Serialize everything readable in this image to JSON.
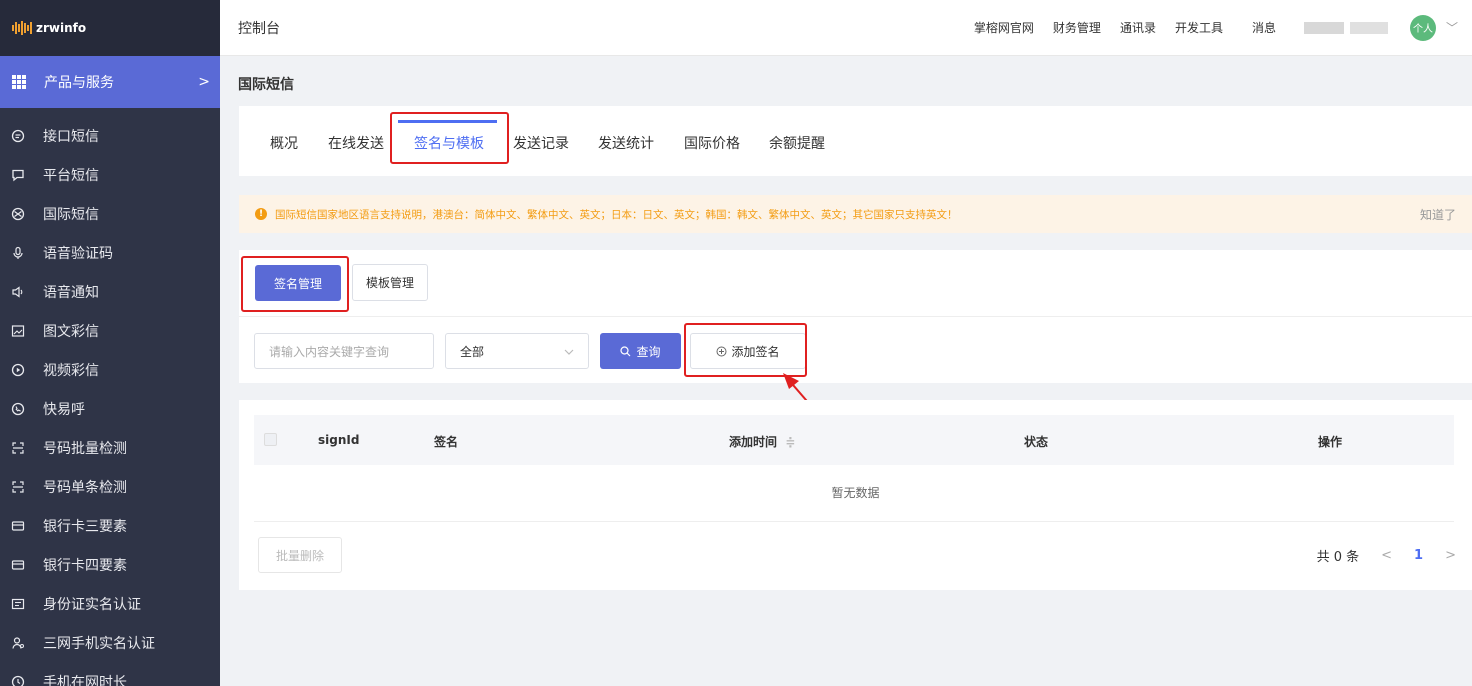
{
  "brand": {
    "name": "zrwinfo",
    "accent": "#f0a030"
  },
  "sidebar": {
    "products_label": "产品与服务",
    "products_arrow": ">",
    "items": [
      {
        "label": "接口短信",
        "icon": "chat-bubble-icon"
      },
      {
        "label": "平台短信",
        "icon": "message-square-icon"
      },
      {
        "label": "国际短信",
        "icon": "globe-icon"
      },
      {
        "label": "语音验证码",
        "icon": "microphone-icon"
      },
      {
        "label": "语音通知",
        "icon": "speaker-icon"
      },
      {
        "label": "图文彩信",
        "icon": "image-icon"
      },
      {
        "label": "视频彩信",
        "icon": "play-circle-icon"
      },
      {
        "label": "快易呼",
        "icon": "phone-circle-icon"
      },
      {
        "label": "号码批量检测",
        "icon": "scan-icon"
      },
      {
        "label": "号码单条检测",
        "icon": "scan-single-icon"
      },
      {
        "label": "银行卡三要素",
        "icon": "card-icon"
      },
      {
        "label": "银行卡四要素",
        "icon": "card-four-icon"
      },
      {
        "label": "身份证实名认证",
        "icon": "id-card-icon"
      },
      {
        "label": "三网手机实名认证",
        "icon": "user-icon"
      },
      {
        "label": "手机在网时长",
        "icon": "clock-icon"
      }
    ]
  },
  "header": {
    "console": "控制台",
    "links": [
      "掌榕网官网",
      "财务管理",
      "通讯录",
      "开发工具"
    ],
    "messages": "消息",
    "avatar_text": "个人",
    "dropdown": "﹀"
  },
  "page": {
    "title": "国际短信"
  },
  "tabs": [
    {
      "label": "概况",
      "active": false
    },
    {
      "label": "在线发送",
      "active": false
    },
    {
      "label": "签名与模板",
      "active": true
    },
    {
      "label": "发送记录",
      "active": false
    },
    {
      "label": "发送统计",
      "active": false
    },
    {
      "label": "国际价格",
      "active": false
    },
    {
      "label": "余额提醒",
      "active": false
    }
  ],
  "notice": {
    "icon": "!",
    "text": "国际短信国家地区语言支持说明，港澳台：简体中文、繁体中文、英文；日本：日文、英文；韩国：韩文、繁体中文、英文；其它国家只支持英文！",
    "dismiss": "知道了",
    "color": "#f39c12"
  },
  "sub_tabs": {
    "sign": "签名管理",
    "template": "模板管理"
  },
  "filter": {
    "search_placeholder": "请输入内容关键字查询",
    "select_value": "全部",
    "query_label": "查询",
    "add_label": "添加签名"
  },
  "table": {
    "columns": [
      "signId",
      "签名",
      "添加时间",
      "状态",
      "操作"
    ],
    "sort_icon": "≑",
    "empty": "暂无数据",
    "batch_delete": "批量删除"
  },
  "pager": {
    "total": "共 0 条",
    "prev": "<",
    "page": "1",
    "next": ">"
  },
  "colors": {
    "primary": "#5a6ad6",
    "sidebar": "#2f3447",
    "highlight": "#e02020"
  }
}
